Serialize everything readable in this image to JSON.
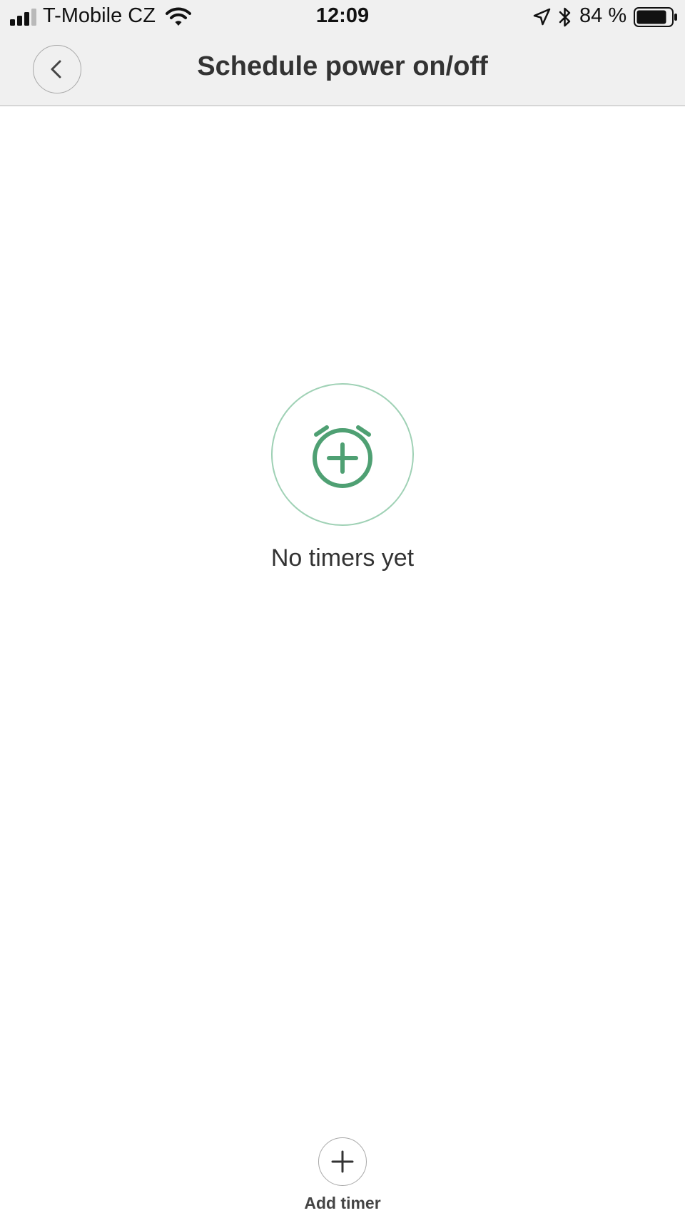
{
  "status_bar": {
    "carrier": "T-Mobile CZ",
    "time": "12:09",
    "battery_percent": "84 %",
    "icons": [
      "signal-icon",
      "wifi-icon",
      "location-arrow-icon",
      "bluetooth-icon",
      "battery-icon"
    ]
  },
  "header": {
    "title": "Schedule power on/off",
    "back_icon": "chevron-left-icon"
  },
  "empty_state": {
    "icon": "alarm-clock-add-icon",
    "message": "No timers yet"
  },
  "add_timer": {
    "icon": "plus-icon",
    "label": "Add timer"
  },
  "colors": {
    "header_background": "#f0f0f0",
    "accent_green": "#4fa073",
    "ring_green": "#9fd1b5",
    "text": "#333333"
  }
}
